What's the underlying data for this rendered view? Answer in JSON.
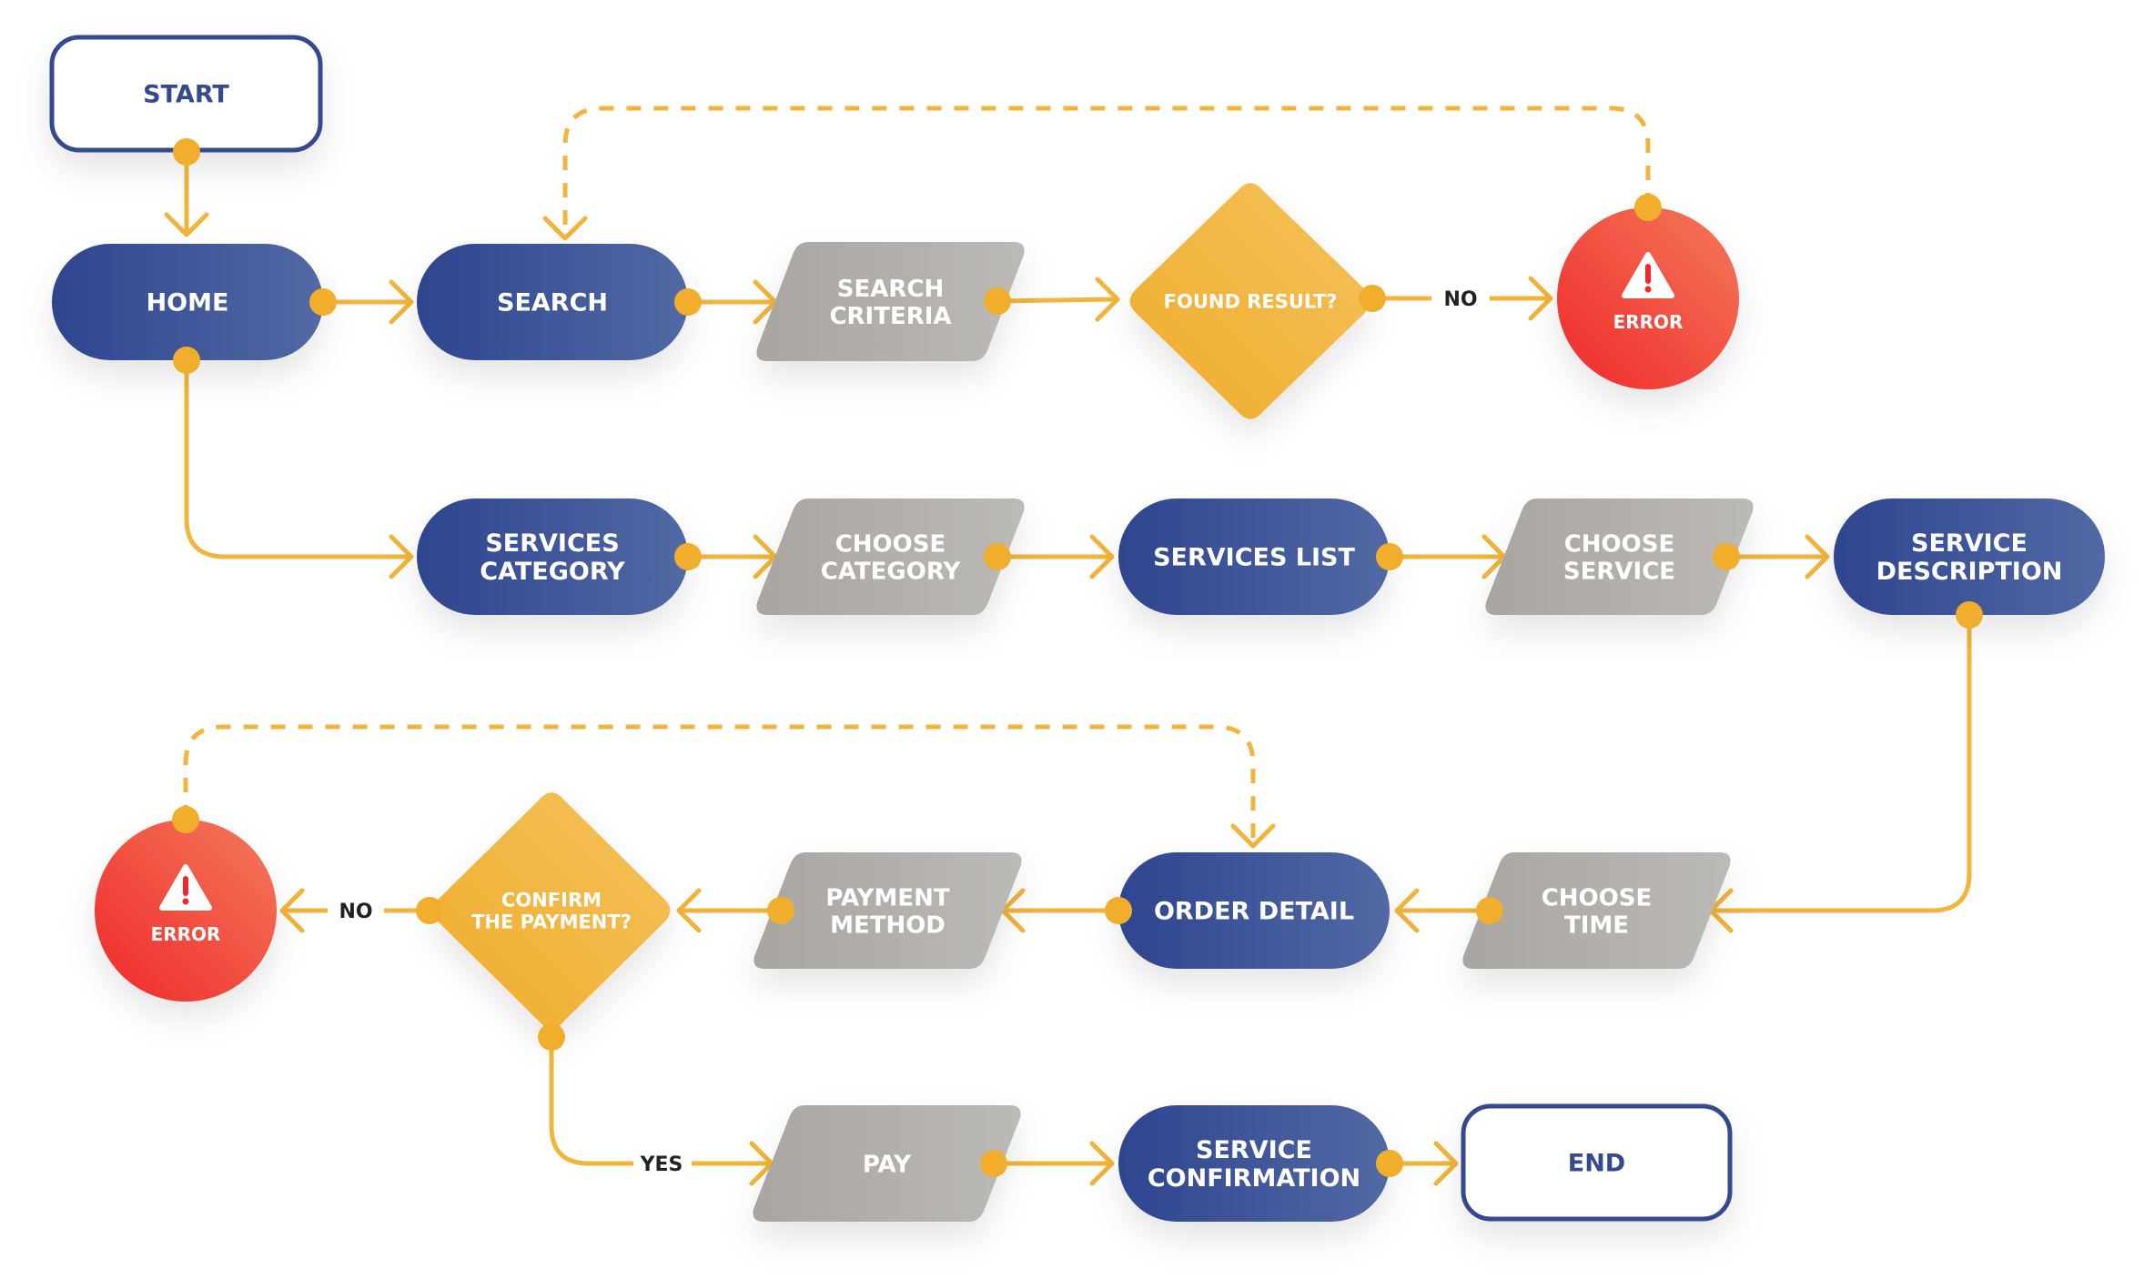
{
  "diagram": {
    "type": "flowchart",
    "colors": {
      "process": "#2e4590",
      "process_light": "#5269a4",
      "io": "#a9a5a1",
      "io_light": "#bcbab6",
      "decision": "#f0ac2a",
      "decision_light": "#f4c25c",
      "error": "#f02828",
      "error_light": "#f37a5c",
      "terminal_border": "#344a8f",
      "connector": "#f2b43a"
    },
    "nodes": {
      "start": {
        "lines": [
          "START"
        ],
        "kind": "terminal"
      },
      "home": {
        "lines": [
          "HOME"
        ],
        "kind": "process"
      },
      "search": {
        "lines": [
          "SEARCH"
        ],
        "kind": "process"
      },
      "search_criteria": {
        "lines": [
          "SEARCH",
          "CRITERIA"
        ],
        "kind": "io"
      },
      "found_result": {
        "lines": [
          "FOUND RESULT?"
        ],
        "kind": "decision"
      },
      "error_1": {
        "lines": [
          "ERROR"
        ],
        "kind": "error"
      },
      "services_category": {
        "lines": [
          "SERVICES",
          "CATEGORY"
        ],
        "kind": "process"
      },
      "choose_category": {
        "lines": [
          "CHOOSE",
          "CATEGORY"
        ],
        "kind": "io"
      },
      "services_list": {
        "lines": [
          "SERVICES LIST"
        ],
        "kind": "process"
      },
      "choose_service": {
        "lines": [
          "CHOOSE",
          "SERVICE"
        ],
        "kind": "io"
      },
      "service_description": {
        "lines": [
          "SERVICE",
          "DESCRIPTION"
        ],
        "kind": "process"
      },
      "choose_time": {
        "lines": [
          "CHOOSE",
          "TIME"
        ],
        "kind": "io"
      },
      "order_detail": {
        "lines": [
          "ORDER DETAIL"
        ],
        "kind": "process"
      },
      "payment_method": {
        "lines": [
          "PAYMENT",
          "METHOD"
        ],
        "kind": "io"
      },
      "confirm_payment": {
        "lines": [
          "CONFIRM",
          "THE PAYMENT?"
        ],
        "kind": "decision"
      },
      "error_2": {
        "lines": [
          "ERROR"
        ],
        "kind": "error"
      },
      "pay": {
        "lines": [
          "PAY"
        ],
        "kind": "io"
      },
      "service_confirmation": {
        "lines": [
          "SERVICE",
          "CONFIRMATION"
        ],
        "kind": "process"
      },
      "end": {
        "lines": [
          "END"
        ],
        "kind": "terminal"
      }
    },
    "edge_labels": {
      "found_no": "NO",
      "confirm_no": "NO",
      "confirm_yes": "YES"
    },
    "edges": [
      {
        "from": "start",
        "to": "home"
      },
      {
        "from": "home",
        "to": "search"
      },
      {
        "from": "search",
        "to": "search_criteria"
      },
      {
        "from": "search_criteria",
        "to": "found_result"
      },
      {
        "from": "found_result",
        "to": "error_1",
        "label": "NO"
      },
      {
        "from": "error_1",
        "to": "search",
        "style": "dashed"
      },
      {
        "from": "home",
        "to": "services_category"
      },
      {
        "from": "services_category",
        "to": "choose_category"
      },
      {
        "from": "choose_category",
        "to": "services_list"
      },
      {
        "from": "services_list",
        "to": "choose_service"
      },
      {
        "from": "choose_service",
        "to": "service_description"
      },
      {
        "from": "service_description",
        "to": "choose_time"
      },
      {
        "from": "choose_time",
        "to": "order_detail"
      },
      {
        "from": "order_detail",
        "to": "payment_method"
      },
      {
        "from": "payment_method",
        "to": "confirm_payment"
      },
      {
        "from": "confirm_payment",
        "to": "error_2",
        "label": "NO"
      },
      {
        "from": "error_2",
        "to": "order_detail",
        "style": "dashed"
      },
      {
        "from": "confirm_payment",
        "to": "pay",
        "label": "YES"
      },
      {
        "from": "pay",
        "to": "service_confirmation"
      },
      {
        "from": "service_confirmation",
        "to": "end"
      }
    ]
  }
}
